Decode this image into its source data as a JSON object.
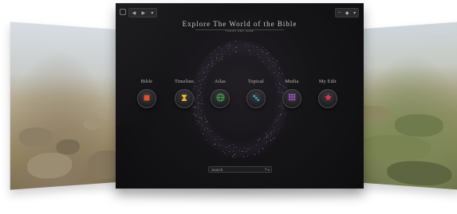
{
  "app": {
    "title": "Explore The World of the Bible",
    "subtitle": "ᴛᴏᴜᴄʜ ᴀɴʏ ɪᴄᴏɴ",
    "titlebar": {
      "back_glyph": "◀",
      "forward_glyph": "▶",
      "menu_glyph": "▾",
      "minimize_glyph": "–",
      "maximize_glyph": "◆",
      "close_glyph": "▾"
    }
  },
  "nav_items": [
    {
      "label": "Bible",
      "icon": "square-icon",
      "color": "#e0502a"
    },
    {
      "label": "Timeline",
      "icon": "hourglass-icon",
      "color": "#e8b02c"
    },
    {
      "label": "Atlas",
      "icon": "globe-icon",
      "color": "#3fae48"
    },
    {
      "label": "Topical",
      "icon": "dots-icon",
      "color": "#3aa6c8"
    },
    {
      "label": "Media",
      "icon": "grid-icon",
      "color": "#9b4fc0"
    },
    {
      "label": "My Edit",
      "icon": "star-icon",
      "color": "#e0364a"
    }
  ],
  "search": {
    "placeholder": "Search",
    "icon_glyph": "⌕",
    "caret_glyph": "▾"
  }
}
